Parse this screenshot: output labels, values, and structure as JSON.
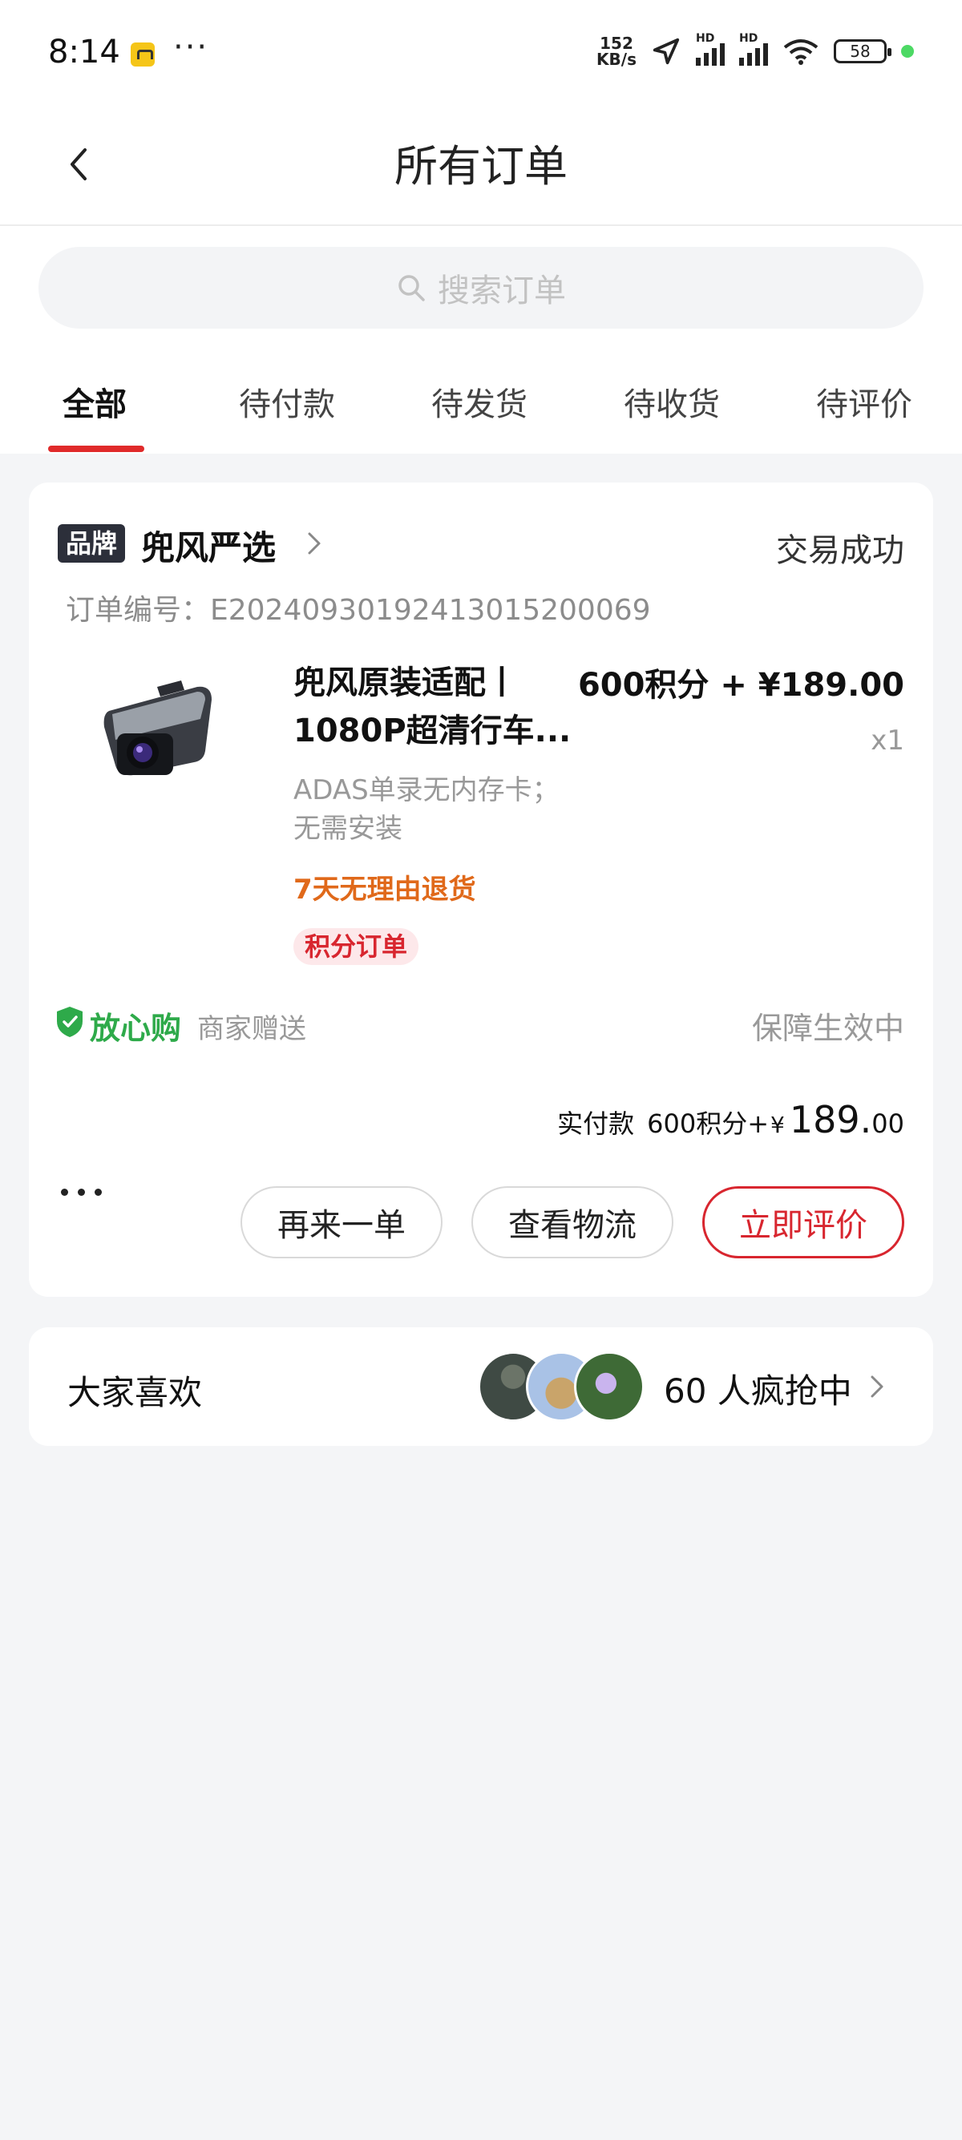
{
  "status_bar": {
    "time": "8:14",
    "speed_value": "152",
    "speed_unit": "KB/s",
    "signal_label_1": "HD",
    "signal_label_2": "HD",
    "battery": "58"
  },
  "header": {
    "title": "所有订单"
  },
  "search": {
    "placeholder": "搜索订单"
  },
  "tabs": [
    {
      "label": "全部",
      "active": true
    },
    {
      "label": "待付款",
      "active": false
    },
    {
      "label": "待发货",
      "active": false
    },
    {
      "label": "待收货",
      "active": false
    },
    {
      "label": "待评价",
      "active": false
    }
  ],
  "order": {
    "brand_badge": "品牌",
    "shop_name": "兜风严选",
    "status": "交易成功",
    "order_number": "订单编号：E20240930192413015200069",
    "product": {
      "title_line1": "兜风原装适配丨",
      "title_line2": "1080P超清行车...",
      "price": "600积分 + ¥189.00",
      "quantity": "x1",
      "spec": "ADAS单录无内存卡；无需安装",
      "return_policy": "7天无理由退货",
      "tag": "积分订单"
    },
    "assurance_label": "放心购",
    "merchant_gift": "商家赠送",
    "guarantee_status": "保障生效中",
    "paid": {
      "label": "实付款",
      "points": "600积分+",
      "currency": "¥",
      "amount_int": "189.",
      "amount_dec": "00"
    },
    "buttons": {
      "reorder": "再来一单",
      "logistics": "查看物流",
      "review": "立即评价"
    }
  },
  "recommend": {
    "title": "大家喜欢",
    "count_text": "60 人疯抢中"
  },
  "colors": {
    "accent_red": "#d8262f",
    "orange": "#e0691a",
    "green": "#2eaa4a"
  },
  "icons": [
    "back-arrow-icon",
    "search-icon",
    "chevron-right-icon",
    "shield-check-icon",
    "more-dots-icon"
  ]
}
